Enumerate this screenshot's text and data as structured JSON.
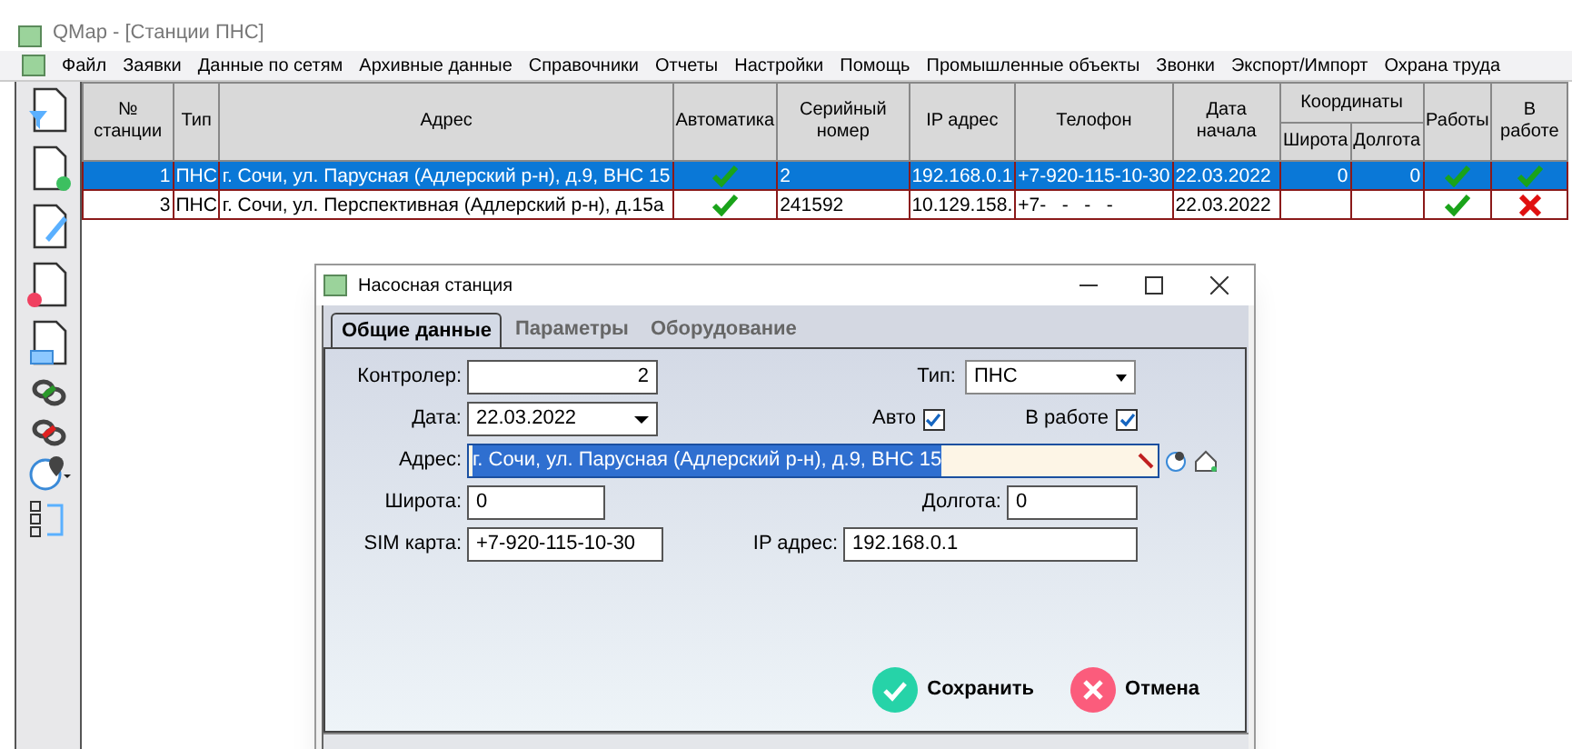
{
  "window": {
    "title": "QMap - [Станции ПНС]"
  },
  "menu": [
    "Файл",
    "Заявки",
    "Данные по сетям",
    "Архивные данные",
    "Справочники",
    "Отчеты",
    "Настройки",
    "Помощь",
    "Промышленные объекты",
    "Звонки",
    "Экспорт/Импорт",
    "Охрана труда"
  ],
  "table": {
    "columns": {
      "number": "№ станции",
      "type": "Тип",
      "address": "Адрес",
      "automation": "Автоматика",
      "serial": "Серийный номер",
      "ip": "IP адрес",
      "phone": "Телофон",
      "date": "Дата начала",
      "coords": "Координаты",
      "lat": "Широта",
      "lon": "Долгота",
      "works": "Работы",
      "in_work": "В работе"
    },
    "rows": [
      {
        "selected": true,
        "number": "1",
        "type": "ПНС",
        "address": "г. Сочи, ул. Парусная (Адлерский р-н), д.9, ВНС 15",
        "automation": true,
        "serial": "2",
        "ip": "192.168.0.1",
        "phone": "+7-920-115-10-30",
        "date": "22.03.2022",
        "lat": "0",
        "lon": "0",
        "works": true,
        "in_work": true
      },
      {
        "selected": false,
        "number": "3",
        "type": "ПНС",
        "address": "г. Сочи, ул. Перспективная (Адлерский р-н), д.15а",
        "automation": true,
        "serial": "241592",
        "ip": "10.129.158.",
        "phone": "+7-   -   -   -",
        "date": "22.03.2022",
        "works": true,
        "in_work": false
      }
    ]
  },
  "dialog": {
    "title": "Насосная станция",
    "tabs": [
      {
        "label": "Общие данные",
        "selected": true
      },
      {
        "label": "Параметры",
        "selected": false
      },
      {
        "label": "Оборудование",
        "selected": false
      }
    ],
    "controller": {
      "label": "Контролер:",
      "value": "2"
    },
    "type": {
      "label": "Тип:",
      "value": "ПНС"
    },
    "date": {
      "label": "Дата:",
      "value": "22.03.2022"
    },
    "auto": {
      "label": "Авто",
      "checked": true
    },
    "in_work": {
      "label": "В работе",
      "checked": true
    },
    "address": {
      "label": "Адрес:",
      "value": "г. Сочи, ул. Парусная (Адлерский р-н), д.9, ВНС 15"
    },
    "lat": {
      "label": "Широта:",
      "value": "0"
    },
    "lon": {
      "label": "Долгота:",
      "value": "0"
    },
    "sim": {
      "label": "SIM карта:",
      "value": "+7-920-115-10-30"
    },
    "ip": {
      "label": "IP адрес:",
      "value": "192.168.0.1"
    },
    "buttons": {
      "save": "Сохранить",
      "cancel": "Отмена"
    }
  }
}
